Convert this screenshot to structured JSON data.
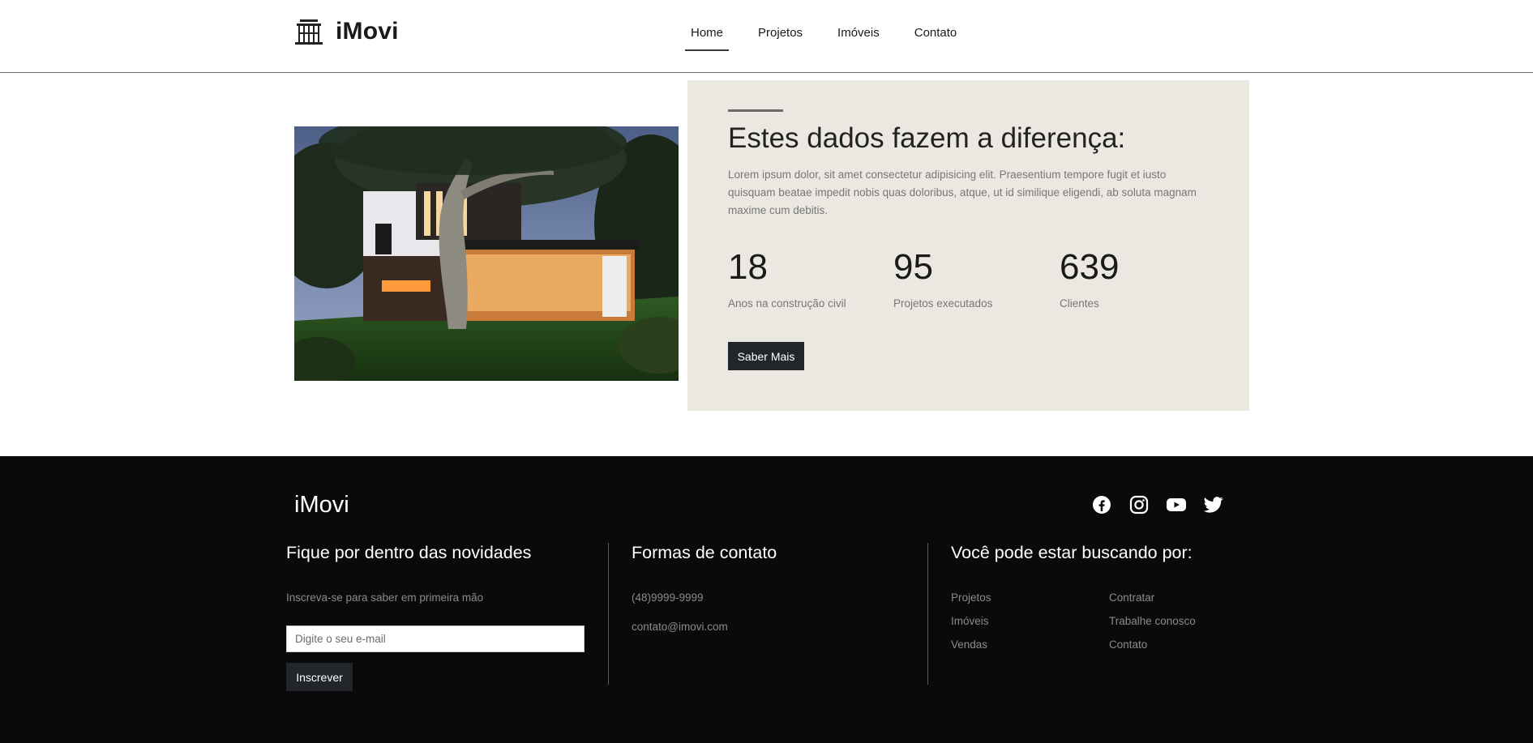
{
  "header": {
    "logo_text": "iMovi",
    "logo_icon": "building-icon",
    "nav": [
      {
        "label": "Home",
        "active": true
      },
      {
        "label": "Projetos",
        "active": false
      },
      {
        "label": "Imóveis",
        "active": false
      },
      {
        "label": "Contato",
        "active": false
      }
    ]
  },
  "hero": {
    "image": "modern-house-photo",
    "title": "Estes dados fazem a diferença:",
    "description": "Lorem ipsum dolor, sit amet consectetur adipisicing elit. Praesentium tempore fugit et iusto quisquam beatae impedit nobis quas doloribus, atque, ut id similique eligendi, ab soluta magnam maxime cum debitis.",
    "stats": [
      {
        "value": "18",
        "label": "Anos na construção civil"
      },
      {
        "value": "95",
        "label": "Projetos executados"
      },
      {
        "value": "639",
        "label": "Clientes"
      }
    ],
    "button_label": "Saber Mais"
  },
  "footer": {
    "logo_text": "iMovi",
    "social_icons": [
      "facebook-icon",
      "instagram-icon",
      "youtube-icon",
      "twitter-icon"
    ],
    "newsletter": {
      "title": "Fique por dentro das novidades",
      "text": "Inscreva-se para saber em primeira mão",
      "placeholder": "Digite o seu e-mail",
      "button_label": "Inscrever"
    },
    "contact": {
      "title": "Formas de contato",
      "phone": "(48)9999-9999",
      "email": "contato@imovi.com"
    },
    "links": {
      "title": "Você pode estar buscando por:",
      "col1": [
        "Projetos",
        "Imóveis",
        "Vendas"
      ],
      "col2": [
        "Contratar",
        "Trabalhe conosco",
        "Contato"
      ]
    }
  },
  "colors": {
    "card_bg": "#ebe8e1",
    "button_bg": "#22262b",
    "footer_bg": "#0a0a0a"
  }
}
